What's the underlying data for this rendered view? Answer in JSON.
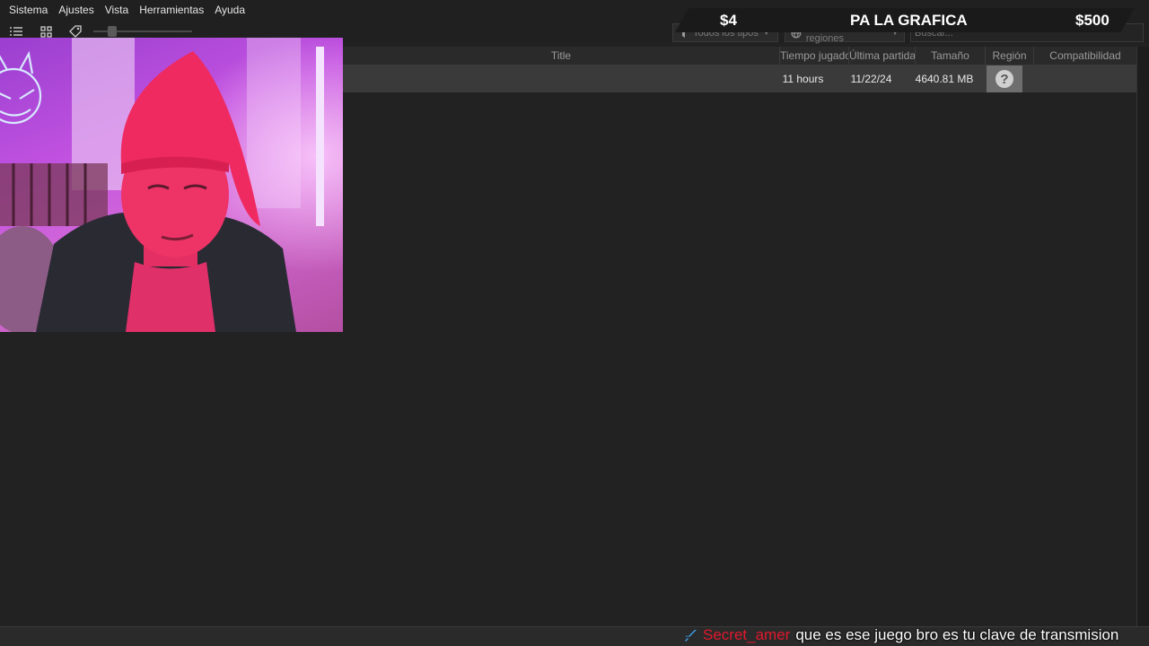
{
  "menu": [
    "Sistema",
    "Ajustes",
    "Vista",
    "Herramientas",
    "Ayuda"
  ],
  "toolbar": {
    "icons": [
      "list-view-icon",
      "grid-view-icon",
      "tag-icon"
    ],
    "filter_types": "Todos los tipos",
    "filter_regions": "Todas las regiones",
    "search_placeholder": "Buscar..."
  },
  "banner": {
    "current": "$4",
    "goal_text": "PA LA GRAFICA",
    "target": "$500"
  },
  "table": {
    "headers": [
      "Title",
      "Tiempo jugado",
      "Última partida",
      "Tamaño",
      "Región",
      "Compatibilidad"
    ],
    "rows": [
      {
        "title": "",
        "time_played": "11 hours",
        "last_played": "11/22/24",
        "size": "4640.81 MB",
        "region": "?",
        "compat": ""
      }
    ]
  },
  "chat": {
    "username": "Secret_amer",
    "message": "que es ese juego bro es tu clave de transmision"
  },
  "colors": {
    "background": "#222222",
    "row_selected": "#3a3a3a",
    "chat_username": "#e0182d",
    "chat_icon": "#3aa0e8"
  }
}
